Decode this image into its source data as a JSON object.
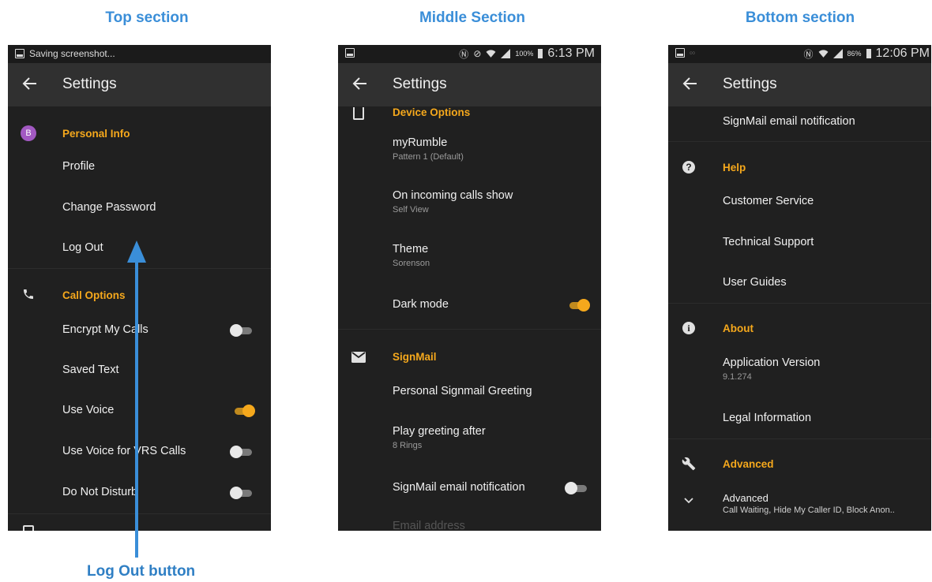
{
  "section_titles": {
    "top": "Top section",
    "middle": "Middle Section",
    "bottom": "Bottom section"
  },
  "callout_label": "Log Out button",
  "phone1": {
    "status": {
      "text": "Saving screenshot..."
    },
    "appbar": {
      "title": "Settings"
    },
    "categories": {
      "personal_info": "Personal Info",
      "call_options": "Call Options"
    },
    "avatar_letter": "B",
    "items": {
      "profile": "Profile",
      "change_password": "Change Password",
      "log_out": "Log Out",
      "encrypt_calls": "Encrypt My Calls",
      "saved_text": "Saved Text",
      "use_voice": "Use Voice",
      "use_voice_vrs": "Use Voice for VRS Calls",
      "do_not_disturb": "Do Not Disturb"
    },
    "toggles": {
      "encrypt_calls": false,
      "use_voice": true,
      "use_voice_vrs": false,
      "do_not_disturb": false
    }
  },
  "phone2": {
    "status": {
      "battery": "100%",
      "time": "6:13 PM"
    },
    "appbar": {
      "title": "Settings"
    },
    "categories": {
      "device_options": "Device Options",
      "signmail": "SignMail"
    },
    "items": {
      "myrumble": "myRumble",
      "myrumble_sub": "Pattern 1 (Default)",
      "incoming_calls": "On incoming calls show",
      "incoming_calls_sub": "Self View",
      "theme": "Theme",
      "theme_sub": "Sorenson",
      "dark_mode": "Dark mode",
      "personal_greeting": "Personal Signmail Greeting",
      "play_greeting": "Play greeting after",
      "play_greeting_sub": "8 Rings",
      "signmail_email": "SignMail email notification",
      "email_address": "Email address"
    },
    "toggles": {
      "dark_mode": true,
      "signmail_email": false
    }
  },
  "phone3": {
    "status": {
      "battery": "86%",
      "time": "12:06 PM"
    },
    "appbar": {
      "title": "Settings"
    },
    "categories": {
      "help": "Help",
      "about": "About",
      "advanced": "Advanced"
    },
    "items": {
      "signmail_email": "SignMail email notification",
      "customer_service": "Customer Service",
      "technical_support": "Technical Support",
      "user_guides": "User Guides",
      "app_version": "Application Version",
      "app_version_sub": "9.1.274",
      "legal_info": "Legal Information",
      "advanced": "Advanced",
      "advanced_sub": "Call Waiting, Hide My Caller ID, Block Anon.."
    }
  },
  "colors": {
    "accent": "#f5a81c",
    "callout_blue": "#3a8ed8",
    "background": "#202020",
    "appbar": "#303030"
  }
}
